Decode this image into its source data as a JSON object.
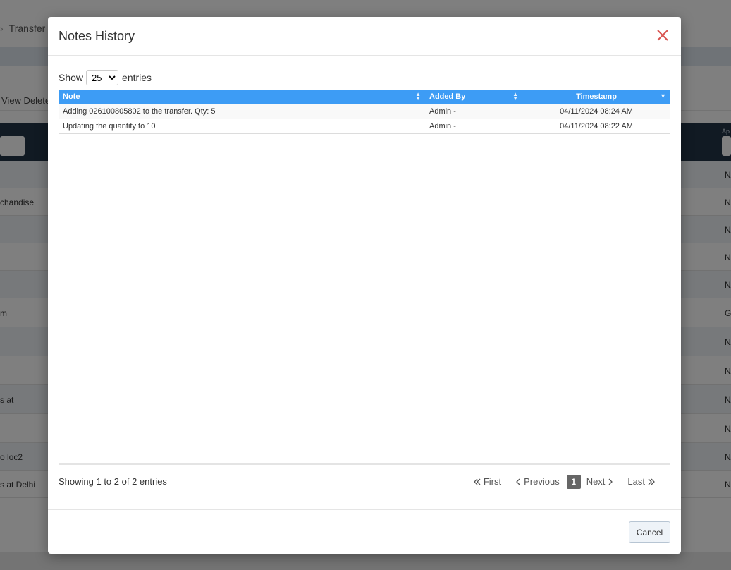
{
  "background": {
    "breadcrumb": "Transfer",
    "toolbar_text": "View Delete",
    "header_label": "Ap",
    "rows": [
      {
        "left": "",
        "right": "N/"
      },
      {
        "left": "chandise",
        "right": "N/"
      },
      {
        "left": "",
        "right": "N/"
      },
      {
        "left": "",
        "right": "N/"
      },
      {
        "left": "",
        "right": "N/"
      },
      {
        "left": "m",
        "right": "Ga"
      },
      {
        "left": "",
        "right": "N/"
      },
      {
        "left": "",
        "right": "N/"
      },
      {
        "left": "s at",
        "right": "N/"
      },
      {
        "left": "",
        "right": "N/"
      },
      {
        "left": "o loc2",
        "right": "N/"
      },
      {
        "left": "s at Delhi",
        "right": "N/"
      }
    ]
  },
  "modal": {
    "title": "Notes History",
    "length": {
      "show": "Show",
      "value": "25",
      "entries": "entries"
    },
    "columns": [
      "Note",
      "Added By",
      "Timestamp"
    ],
    "rows": [
      {
        "note": "Adding 026100805802 to the transfer. Qty: 5",
        "added_by": "Admin -",
        "timestamp": "04/11/2024 08:24 AM"
      },
      {
        "note": "Updating the quantity to 10",
        "added_by": "Admin -",
        "timestamp": "04/11/2024 08:22 AM"
      }
    ],
    "info": "Showing 1 to 2 of 2 entries",
    "pager": {
      "first": "First",
      "previous": "Previous",
      "current": "1",
      "next": "Next",
      "last": "Last"
    },
    "cancel_label": "Cancel",
    "close_color": "#d9534f",
    "header_color": "#3d9cf5"
  }
}
